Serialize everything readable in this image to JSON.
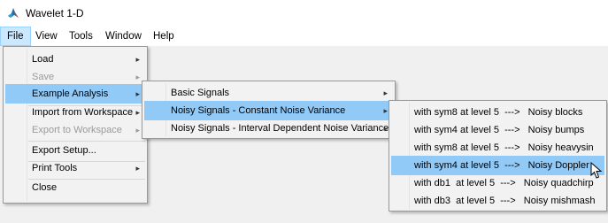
{
  "window": {
    "title": "Wavelet 1-D"
  },
  "menubar": {
    "items": [
      {
        "label": "File",
        "active": true
      },
      {
        "label": "View",
        "active": false
      },
      {
        "label": "Tools",
        "active": false
      },
      {
        "label": "Window",
        "active": false
      },
      {
        "label": "Help",
        "active": false
      }
    ]
  },
  "file_menu": {
    "items": [
      {
        "label": "Load",
        "submenu": true,
        "enabled": true
      },
      {
        "label": "Save",
        "submenu": true,
        "enabled": false
      },
      {
        "label": "Example Analysis",
        "submenu": true,
        "enabled": true,
        "highlighted": true
      },
      {
        "label": "Import from Workspace",
        "submenu": true,
        "enabled": true
      },
      {
        "label": "Export to Workspace",
        "submenu": true,
        "enabled": false
      },
      {
        "label": "Export Setup...",
        "submenu": false,
        "enabled": true
      },
      {
        "label": "Print Tools",
        "submenu": true,
        "enabled": true
      },
      {
        "label": "Close",
        "submenu": false,
        "enabled": true
      }
    ]
  },
  "example_menu": {
    "items": [
      {
        "label": "Basic Signals",
        "submenu": true
      },
      {
        "label": "Noisy Signals - Constant Noise Variance",
        "submenu": true,
        "highlighted": true
      },
      {
        "label": "Noisy Signals - Interval Dependent Noise Variance",
        "submenu": true
      }
    ]
  },
  "noisy_menu": {
    "items": [
      {
        "label": "with sym8 at level 5  --->   Noisy blocks"
      },
      {
        "label": "with sym4 at level 5  --->   Noisy bumps"
      },
      {
        "label": "with sym8 at level 5  --->   Noisy heavysin"
      },
      {
        "label": "with sym4 at level 5  --->   Noisy Doppler",
        "highlighted": true
      },
      {
        "label": "with db1  at level 5  --->   Noisy quadchirp"
      },
      {
        "label": "with db3  at level 5  --->   Noisy mishmash"
      }
    ]
  },
  "colors": {
    "highlight": "#91c9f7",
    "menubar_active": "#cce8ff",
    "disabled_text": "#9a9a9a"
  },
  "icons": {
    "arrow": "▸",
    "app": "matlab-icon",
    "pointer": "mouse-pointer-icon"
  }
}
